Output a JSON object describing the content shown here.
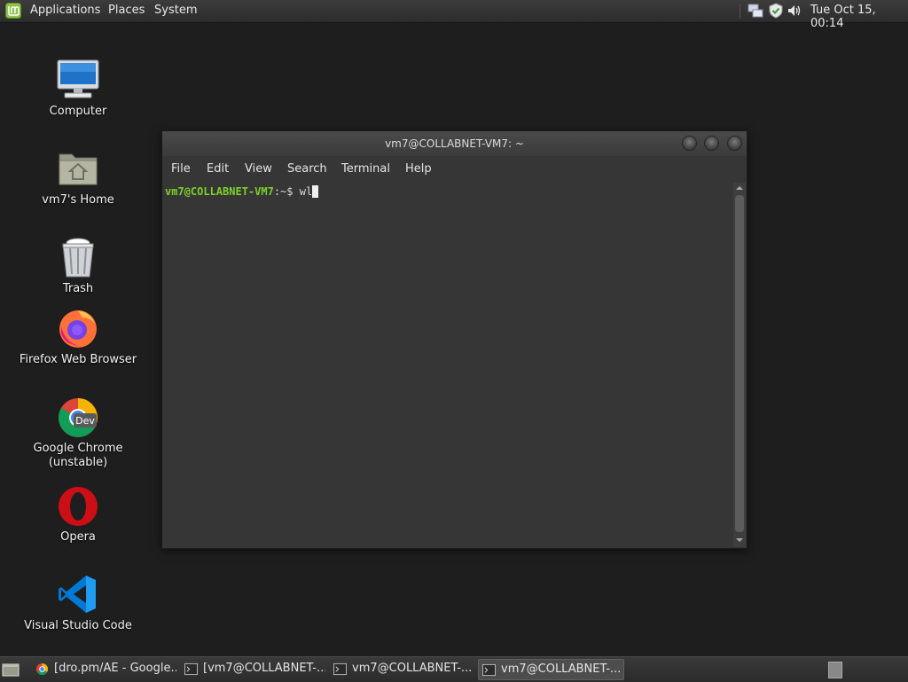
{
  "top_panel": {
    "menus": {
      "applications": "Applications",
      "places": "Places",
      "system": "System"
    },
    "clock": "Tue Oct 15, 00:14",
    "tray_icons": [
      "network-icon",
      "shield-icon",
      "volume-icon"
    ]
  },
  "desktop": {
    "icons": [
      {
        "label": "Computer",
        "icon": "computer-icon"
      },
      {
        "label": "vm7's Home",
        "icon": "home-folder-icon"
      },
      {
        "label": "Trash",
        "icon": "trash-icon"
      },
      {
        "label": "Firefox Web Browser",
        "icon": "firefox-icon"
      },
      {
        "label": "Google Chrome\n(unstable)",
        "icon": "chrome-dev-icon",
        "badge": "Dev"
      },
      {
        "label": "Opera",
        "icon": "opera-icon"
      },
      {
        "label": "Visual Studio Code",
        "icon": "vscode-icon"
      }
    ]
  },
  "terminal": {
    "title": "vm7@COLLABNET-VM7: ~",
    "menu": [
      "File",
      "Edit",
      "View",
      "Search",
      "Terminal",
      "Help"
    ],
    "prompt_user": "vm7@COLLABNET-VM7",
    "prompt_path": ":~$ ",
    "command": "wl"
  },
  "taskbar": {
    "tasks": [
      {
        "label": "[dro.pm/AE - Google...",
        "icon": "chrome-icon",
        "active": false
      },
      {
        "label": "[vm7@COLLABNET-...",
        "icon": "terminal-icon",
        "active": false
      },
      {
        "label": "vm7@COLLABNET-...",
        "icon": "terminal-icon",
        "active": false
      },
      {
        "label": "vm7@COLLABNET-...",
        "icon": "terminal-icon",
        "active": true
      }
    ]
  },
  "colors": {
    "desktop_bg": "#1e1e1e",
    "terminal_bg": "#363636",
    "prompt_user": "#7fcf2a",
    "mint_green": "#8fc34a"
  }
}
